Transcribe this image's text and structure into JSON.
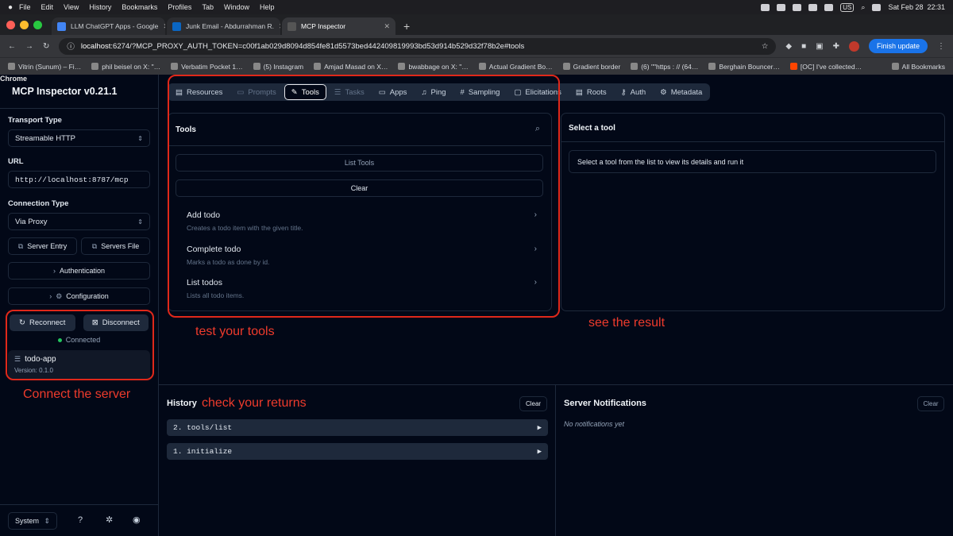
{
  "os_menu": {
    "apple": "",
    "app": "Chrome",
    "items": [
      "File",
      "Edit",
      "View",
      "History",
      "Bookmarks",
      "Profiles",
      "Tab",
      "Window",
      "Help"
    ],
    "clock": "Sat Feb 28  22:31",
    "lang": "US"
  },
  "browser": {
    "tabs": [
      {
        "label": "LLM ChatGPT Apps - Google"
      },
      {
        "label": "Junk Email - Abdurrahman R."
      },
      {
        "label": "MCP Inspector"
      }
    ],
    "new_tab": "+",
    "url_host": "localhost",
    "url_rest": ":6274/?MCP_PROXY_AUTH_TOKEN=c00f1ab029d8094d854fe81d5573bed442409819993bd53d914b529d32f78b2e#tools",
    "finish_update": "Finish update",
    "bookmarks": [
      "Vitrin (Sunum) – Fi…",
      "phil beisel on X: \"…",
      "Verbatim Pocket 1…",
      "(5) Instagram",
      "Amjad Masad on X…",
      "bwabbage on X: \"…",
      "Actual Gradient Bo…",
      "Gradient border",
      "(6) \"\"https : // (64…",
      "Berghain Bouncer…",
      "[OC] I've collected…"
    ],
    "all_bookmarks": "All Bookmarks"
  },
  "sidebar": {
    "title": "MCP Inspector v0.21.1",
    "transport_label": "Transport Type",
    "transport_value": "Streamable HTTP",
    "url_label": "URL",
    "url_value": "http://localhost:8787/mcp",
    "connection_label": "Connection Type",
    "connection_value": "Via Proxy",
    "server_entry": "Server Entry",
    "servers_file": "Servers File",
    "authentication": "Authentication",
    "configuration": "Configuration",
    "reconnect": "Reconnect",
    "disconnect": "Disconnect",
    "status": "Connected",
    "server_name": "todo-app",
    "server_version": "Version: 0.1.0",
    "theme": "System"
  },
  "main_tabs": [
    {
      "label": "Resources",
      "icon": "resources-icon",
      "state": "normal"
    },
    {
      "label": "Prompts",
      "icon": "prompts-icon",
      "state": "dim"
    },
    {
      "label": "Tools",
      "icon": "wrench-icon",
      "state": "active"
    },
    {
      "label": "Tasks",
      "icon": "tasks-icon",
      "state": "dim"
    },
    {
      "label": "Apps",
      "icon": "apps-icon",
      "state": "normal"
    },
    {
      "label": "Ping",
      "icon": "bell-icon",
      "state": "normal"
    },
    {
      "label": "Sampling",
      "icon": "hash-icon",
      "state": "normal"
    },
    {
      "label": "Elicitations",
      "icon": "message-icon",
      "state": "normal"
    },
    {
      "label": "Roots",
      "icon": "folder-icon",
      "state": "normal"
    },
    {
      "label": "Auth",
      "icon": "key-icon",
      "state": "normal"
    },
    {
      "label": "Metadata",
      "icon": "gear-icon",
      "state": "normal"
    }
  ],
  "tools_panel": {
    "title": "Tools",
    "list_tools": "List Tools",
    "clear": "Clear",
    "tools": [
      {
        "name": "Add todo",
        "desc": "Creates a todo item with the given title."
      },
      {
        "name": "Complete todo",
        "desc": "Marks a todo as done by id."
      },
      {
        "name": "List todos",
        "desc": "Lists all todo items."
      }
    ]
  },
  "detail_panel": {
    "title": "Select a tool",
    "hint": "Select a tool from the list to view its details and run it"
  },
  "history": {
    "title": "History",
    "clear": "Clear",
    "rows": [
      "2. tools/list",
      "1. initialize"
    ]
  },
  "notifications": {
    "title": "Server Notifications",
    "clear": "Clear",
    "empty": "No notifications yet"
  },
  "annotations": {
    "tools": "test your tools",
    "result": "see the result",
    "connect": "Connect the server",
    "history": "check your returns"
  },
  "colors": {
    "annotation": "#e0281a",
    "bg": "#020817",
    "border": "#1e293b",
    "status_green": "#22c55e"
  }
}
